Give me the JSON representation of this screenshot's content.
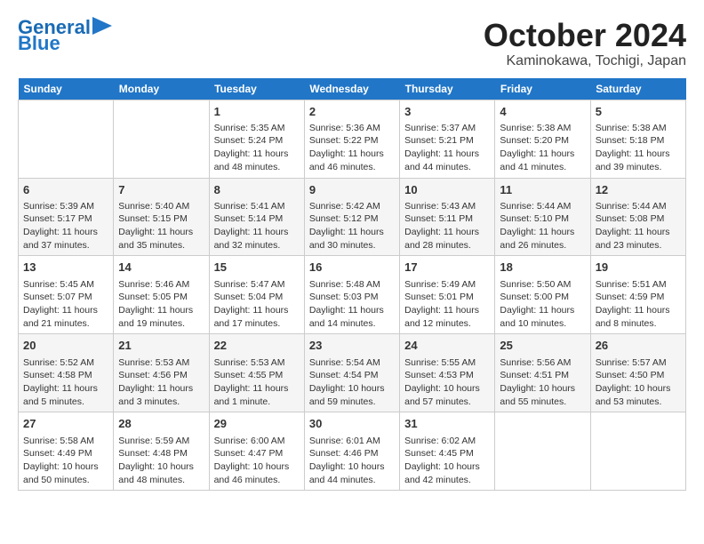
{
  "header": {
    "logo_line1": "General",
    "logo_line2": "Blue",
    "month": "October 2024",
    "location": "Kaminokawa, Tochigi, Japan"
  },
  "days_of_week": [
    "Sunday",
    "Monday",
    "Tuesday",
    "Wednesday",
    "Thursday",
    "Friday",
    "Saturday"
  ],
  "weeks": [
    [
      {
        "day": "",
        "content": ""
      },
      {
        "day": "",
        "content": ""
      },
      {
        "day": "1",
        "content": "Sunrise: 5:35 AM\nSunset: 5:24 PM\nDaylight: 11 hours and 48 minutes."
      },
      {
        "day": "2",
        "content": "Sunrise: 5:36 AM\nSunset: 5:22 PM\nDaylight: 11 hours and 46 minutes."
      },
      {
        "day": "3",
        "content": "Sunrise: 5:37 AM\nSunset: 5:21 PM\nDaylight: 11 hours and 44 minutes."
      },
      {
        "day": "4",
        "content": "Sunrise: 5:38 AM\nSunset: 5:20 PM\nDaylight: 11 hours and 41 minutes."
      },
      {
        "day": "5",
        "content": "Sunrise: 5:38 AM\nSunset: 5:18 PM\nDaylight: 11 hours and 39 minutes."
      }
    ],
    [
      {
        "day": "6",
        "content": "Sunrise: 5:39 AM\nSunset: 5:17 PM\nDaylight: 11 hours and 37 minutes."
      },
      {
        "day": "7",
        "content": "Sunrise: 5:40 AM\nSunset: 5:15 PM\nDaylight: 11 hours and 35 minutes."
      },
      {
        "day": "8",
        "content": "Sunrise: 5:41 AM\nSunset: 5:14 PM\nDaylight: 11 hours and 32 minutes."
      },
      {
        "day": "9",
        "content": "Sunrise: 5:42 AM\nSunset: 5:12 PM\nDaylight: 11 hours and 30 minutes."
      },
      {
        "day": "10",
        "content": "Sunrise: 5:43 AM\nSunset: 5:11 PM\nDaylight: 11 hours and 28 minutes."
      },
      {
        "day": "11",
        "content": "Sunrise: 5:44 AM\nSunset: 5:10 PM\nDaylight: 11 hours and 26 minutes."
      },
      {
        "day": "12",
        "content": "Sunrise: 5:44 AM\nSunset: 5:08 PM\nDaylight: 11 hours and 23 minutes."
      }
    ],
    [
      {
        "day": "13",
        "content": "Sunrise: 5:45 AM\nSunset: 5:07 PM\nDaylight: 11 hours and 21 minutes."
      },
      {
        "day": "14",
        "content": "Sunrise: 5:46 AM\nSunset: 5:05 PM\nDaylight: 11 hours and 19 minutes."
      },
      {
        "day": "15",
        "content": "Sunrise: 5:47 AM\nSunset: 5:04 PM\nDaylight: 11 hours and 17 minutes."
      },
      {
        "day": "16",
        "content": "Sunrise: 5:48 AM\nSunset: 5:03 PM\nDaylight: 11 hours and 14 minutes."
      },
      {
        "day": "17",
        "content": "Sunrise: 5:49 AM\nSunset: 5:01 PM\nDaylight: 11 hours and 12 minutes."
      },
      {
        "day": "18",
        "content": "Sunrise: 5:50 AM\nSunset: 5:00 PM\nDaylight: 11 hours and 10 minutes."
      },
      {
        "day": "19",
        "content": "Sunrise: 5:51 AM\nSunset: 4:59 PM\nDaylight: 11 hours and 8 minutes."
      }
    ],
    [
      {
        "day": "20",
        "content": "Sunrise: 5:52 AM\nSunset: 4:58 PM\nDaylight: 11 hours and 5 minutes."
      },
      {
        "day": "21",
        "content": "Sunrise: 5:53 AM\nSunset: 4:56 PM\nDaylight: 11 hours and 3 minutes."
      },
      {
        "day": "22",
        "content": "Sunrise: 5:53 AM\nSunset: 4:55 PM\nDaylight: 11 hours and 1 minute."
      },
      {
        "day": "23",
        "content": "Sunrise: 5:54 AM\nSunset: 4:54 PM\nDaylight: 10 hours and 59 minutes."
      },
      {
        "day": "24",
        "content": "Sunrise: 5:55 AM\nSunset: 4:53 PM\nDaylight: 10 hours and 57 minutes."
      },
      {
        "day": "25",
        "content": "Sunrise: 5:56 AM\nSunset: 4:51 PM\nDaylight: 10 hours and 55 minutes."
      },
      {
        "day": "26",
        "content": "Sunrise: 5:57 AM\nSunset: 4:50 PM\nDaylight: 10 hours and 53 minutes."
      }
    ],
    [
      {
        "day": "27",
        "content": "Sunrise: 5:58 AM\nSunset: 4:49 PM\nDaylight: 10 hours and 50 minutes."
      },
      {
        "day": "28",
        "content": "Sunrise: 5:59 AM\nSunset: 4:48 PM\nDaylight: 10 hours and 48 minutes."
      },
      {
        "day": "29",
        "content": "Sunrise: 6:00 AM\nSunset: 4:47 PM\nDaylight: 10 hours and 46 minutes."
      },
      {
        "day": "30",
        "content": "Sunrise: 6:01 AM\nSunset: 4:46 PM\nDaylight: 10 hours and 44 minutes."
      },
      {
        "day": "31",
        "content": "Sunrise: 6:02 AM\nSunset: 4:45 PM\nDaylight: 10 hours and 42 minutes."
      },
      {
        "day": "",
        "content": ""
      },
      {
        "day": "",
        "content": ""
      }
    ]
  ]
}
